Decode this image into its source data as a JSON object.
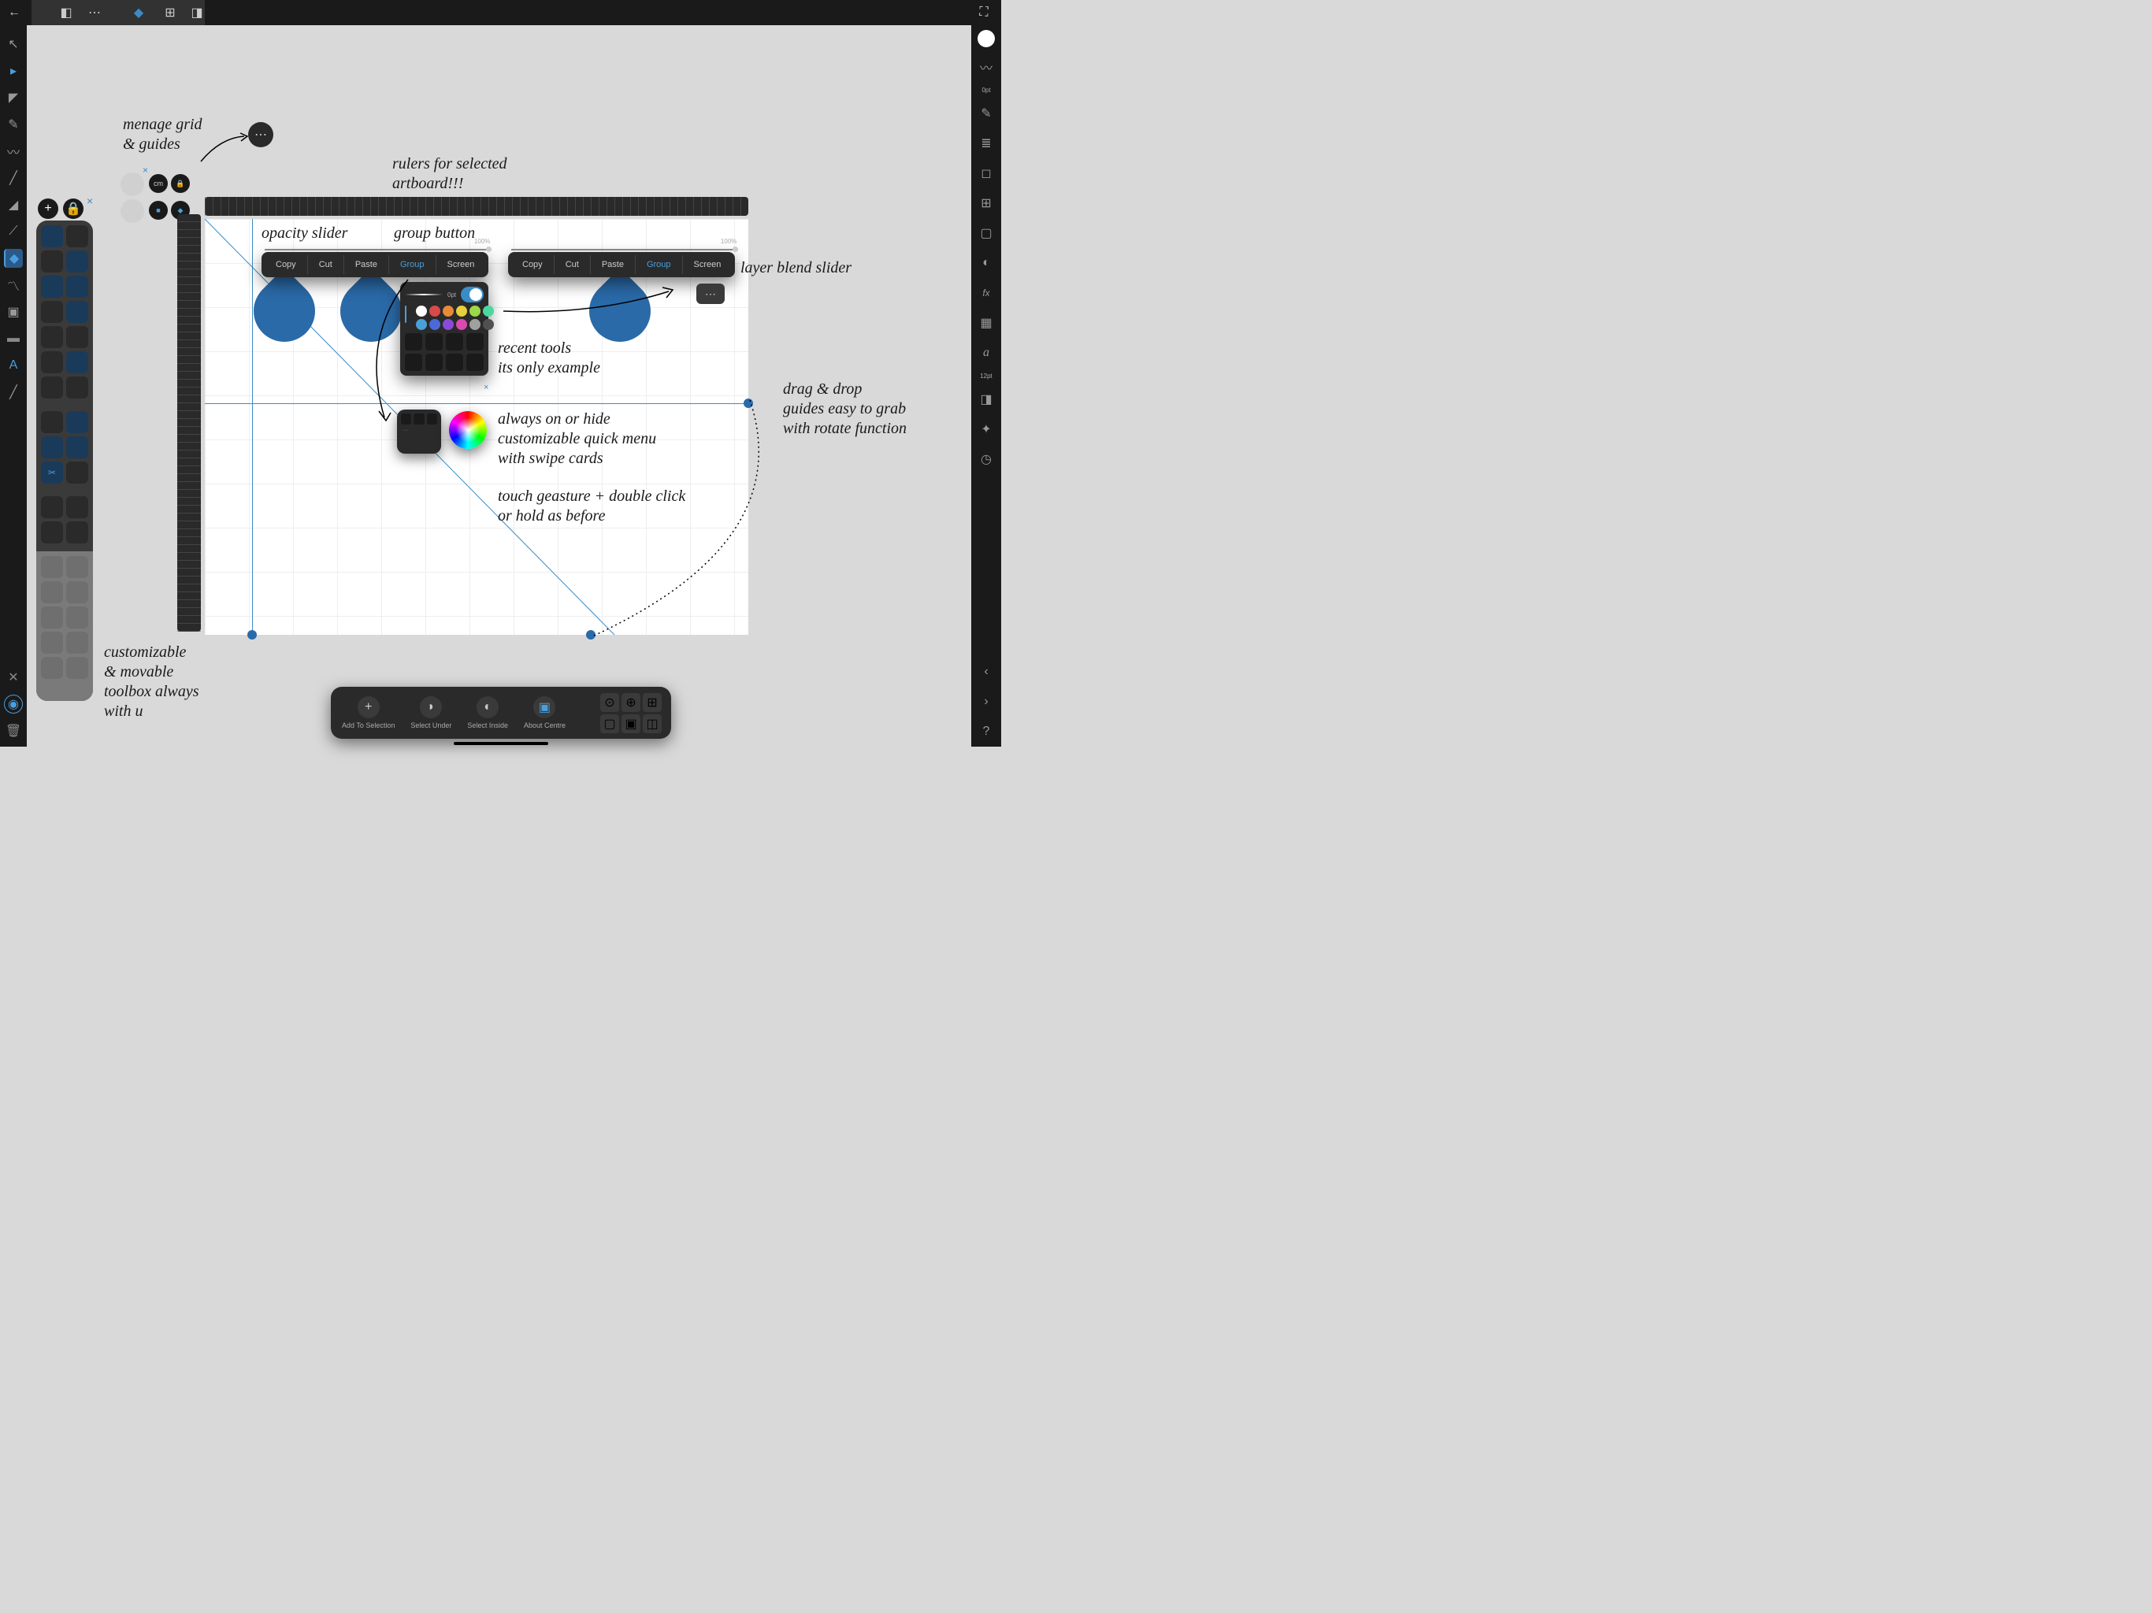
{
  "topbar": {
    "doc_icon": "◧",
    "more_icon": "⋯",
    "grid_icon": "⊞",
    "panel_icon": "◨"
  },
  "rightbar": {
    "stroke_pt": "0pt",
    "font_size": "12pt"
  },
  "ctx1": {
    "copy": "Copy",
    "cut": "Cut",
    "paste": "Paste",
    "group": "Group",
    "screen": "Screen",
    "slider": "100%"
  },
  "ctx2": {
    "copy": "Copy",
    "cut": "Cut",
    "paste": "Paste",
    "group": "Group",
    "screen": "Screen",
    "slider": "100%"
  },
  "tool_panel": {
    "brush_pt": "0pt"
  },
  "grid_mgr": {
    "cm": "cm"
  },
  "ann": {
    "grid": "menage grid\n& guides",
    "rulers": "rulers for selected\nartboard!!!",
    "opacity": "opacity slider",
    "groupbtn": "group button",
    "blend": "layer blend slider",
    "recent": "recent tools\nits only example",
    "quick": "always on or hide\ncustomizable quick menu\nwith swipe cards",
    "touch": "touch geasture + double click\nor hold as before",
    "drag": "drag & drop\nguides easy to grab\nwith rotate function",
    "toolbox": "customizable\n& movable\ntoolbox always\nwith u"
  },
  "bottombar": {
    "add": "Add To Selection",
    "under": "Select Under",
    "inside": "Select Inside",
    "centre": "About Centre"
  },
  "swatches": [
    "#ffffff",
    "#d84a4a",
    "#e88a3a",
    "#e8d03a",
    "#9ad84a",
    "#4ad8a0",
    "#4aa0d8",
    "#4a6ad8",
    "#8a4ad8",
    "#d84ab0",
    "#a0a0a0",
    "#505050"
  ],
  "help": "?"
}
